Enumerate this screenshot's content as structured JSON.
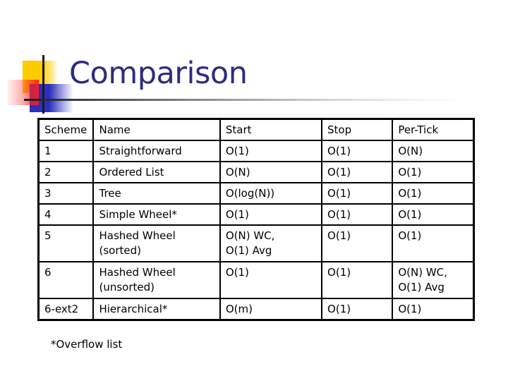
{
  "slide": {
    "title": "Comparison",
    "footnote": "*Overflow list"
  },
  "colors": {
    "title": "#2b2d80",
    "logo_yellow": "#ffcc00",
    "logo_red": "#ff1a1a",
    "logo_blue": "#2a2fc0",
    "table_border": "#000000"
  },
  "table": {
    "headers": [
      "Scheme",
      "Name",
      "Start",
      "Stop",
      "Per-Tick"
    ],
    "rows": [
      {
        "scheme": "1",
        "name": "Straightforward",
        "start": "O(1)",
        "stop": "O(1)",
        "per_tick": "O(N)"
      },
      {
        "scheme": "2",
        "name": "Ordered List",
        "start": "O(N)",
        "stop": "O(1)",
        "per_tick": "O(1)"
      },
      {
        "scheme": "3",
        "name": "Tree",
        "start": "O(log(N))",
        "stop": "O(1)",
        "per_tick": "O(1)"
      },
      {
        "scheme": "4",
        "name": "Simple Wheel*",
        "start": "O(1)",
        "stop": "O(1)",
        "per_tick": "O(1)"
      },
      {
        "scheme": "5",
        "name": "Hashed Wheel\n(sorted)",
        "start": "O(N) WC,\nO(1) Avg",
        "stop": "O(1)",
        "per_tick": "O(1)"
      },
      {
        "scheme": "6",
        "name": "Hashed Wheel\n(unsorted)",
        "start": "O(1)",
        "stop": "O(1)",
        "per_tick": "O(N) WC,\nO(1) Avg"
      },
      {
        "scheme": "6-ext2",
        "name": "Hierarchical*",
        "start": "O(m)",
        "stop": "O(1)",
        "per_tick": "O(1)"
      }
    ]
  }
}
